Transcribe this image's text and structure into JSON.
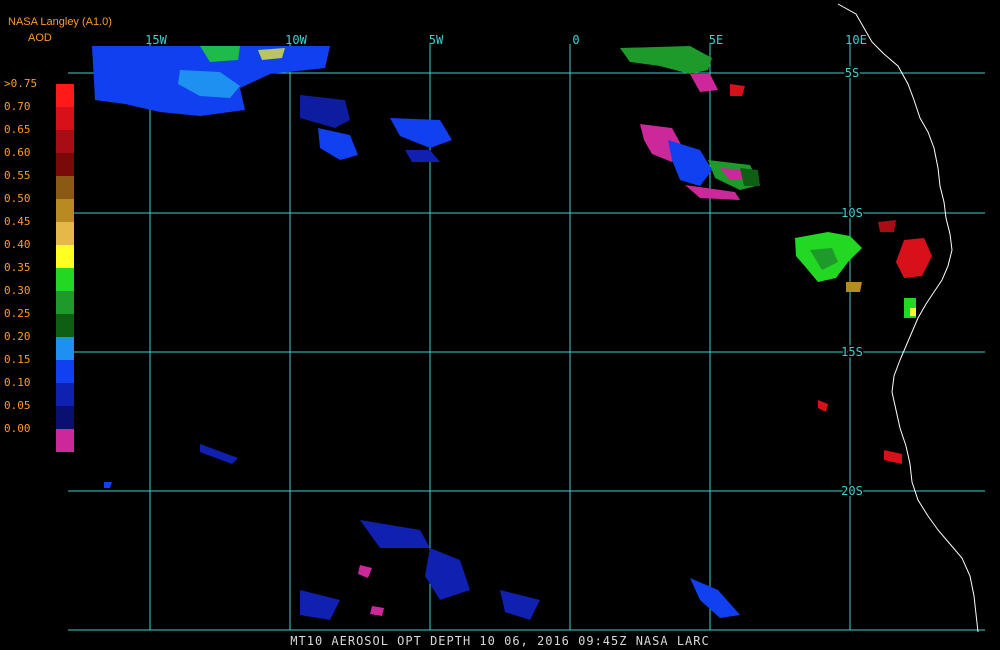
{
  "header": {
    "title": "NASA Langley (A1.0)",
    "units": "AOD"
  },
  "legend": {
    "labels": [
      ">0.75",
      "0.70",
      "0.65",
      "0.60",
      "0.55",
      "0.50",
      "0.45",
      "0.40",
      "0.35",
      "0.30",
      "0.25",
      "0.20",
      "0.15",
      "0.10",
      "0.05",
      "0.00"
    ],
    "colors": [
      "#ff1a1a",
      "#d8101a",
      "#a80c14",
      "#7a0a0a",
      "#8a5a14",
      "#b88a22",
      "#e6b84a",
      "#ffff22",
      "#22d822",
      "#1e9a2a",
      "#0e5e14",
      "#1e90f0",
      "#1040f0",
      "#1020b0",
      "#0a1070",
      "#cc2899"
    ]
  },
  "map": {
    "grid_color": "#40d0d0",
    "coast_color": "#ffffff",
    "lon_labels": [
      "15W",
      "10W",
      "5W",
      "0",
      "5E",
      "10E"
    ],
    "lat_labels": [
      "5S",
      "10S",
      "15S",
      "20S"
    ]
  },
  "footer": {
    "text": "MT10  AEROSOL OPT DEPTH   10 06, 2016 09:45Z   NASA LARC"
  }
}
